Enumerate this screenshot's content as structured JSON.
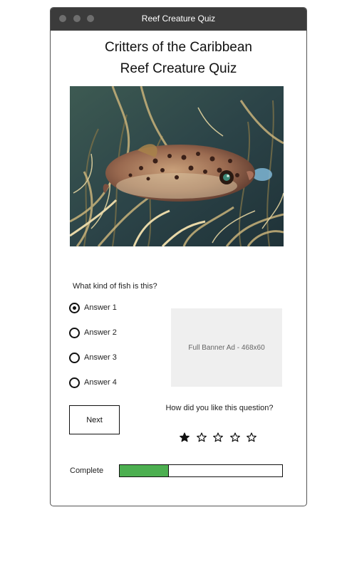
{
  "window": {
    "title": "Reef Creature Quiz"
  },
  "header": {
    "line1": "Critters of the Caribbean",
    "line2": "Reef Creature Quiz"
  },
  "photo": {
    "subject": "porcupinefish among sea fans"
  },
  "quiz": {
    "question": "What kind of fish is this?",
    "answers": [
      {
        "label": "Answer 1",
        "selected": true
      },
      {
        "label": "Answer 2",
        "selected": false
      },
      {
        "label": "Answer 3",
        "selected": false
      },
      {
        "label": "Answer 4",
        "selected": false
      }
    ],
    "next_label": "Next"
  },
  "ad": {
    "label": "Full Banner Ad - 468x60"
  },
  "rating": {
    "question": "How did you like this question?",
    "max": 5,
    "value": 1
  },
  "progress": {
    "label": "Complete",
    "fraction": 0.3,
    "fill_color": "#4caf50"
  }
}
